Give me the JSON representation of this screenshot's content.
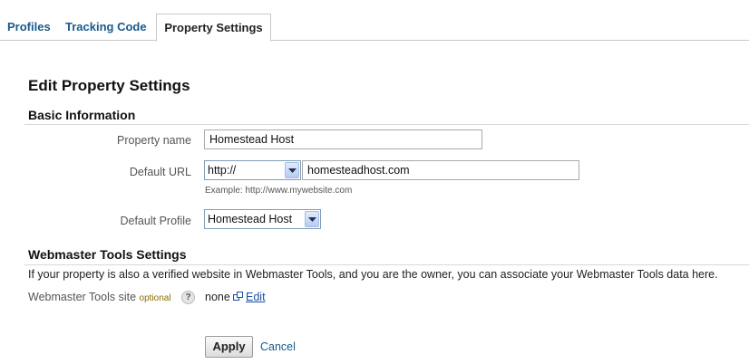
{
  "tabs": [
    {
      "label": "Profiles"
    },
    {
      "label": "Tracking Code"
    },
    {
      "label": "Property Settings"
    }
  ],
  "page_title": "Edit Property Settings",
  "basic": {
    "title": "Basic Information",
    "property_name_label": "Property name",
    "property_name_value": "Homestead Host",
    "default_url_label": "Default URL",
    "protocol_value": "http://",
    "url_value": "homesteadhost.com",
    "example": "Example: http://www.mywebsite.com",
    "default_profile_label": "Default Profile",
    "default_profile_value": "Homestead Host"
  },
  "webmaster": {
    "title": "Webmaster Tools Settings",
    "description": "If your property is also a verified website in Webmaster Tools, and you are the owner, you can associate your Webmaster Tools data here.",
    "site_label": "Webmaster Tools site",
    "optional": "optional",
    "help": "?",
    "site_value": "none",
    "edit_label": "Edit"
  },
  "actions": {
    "apply": "Apply",
    "cancel": "Cancel"
  }
}
